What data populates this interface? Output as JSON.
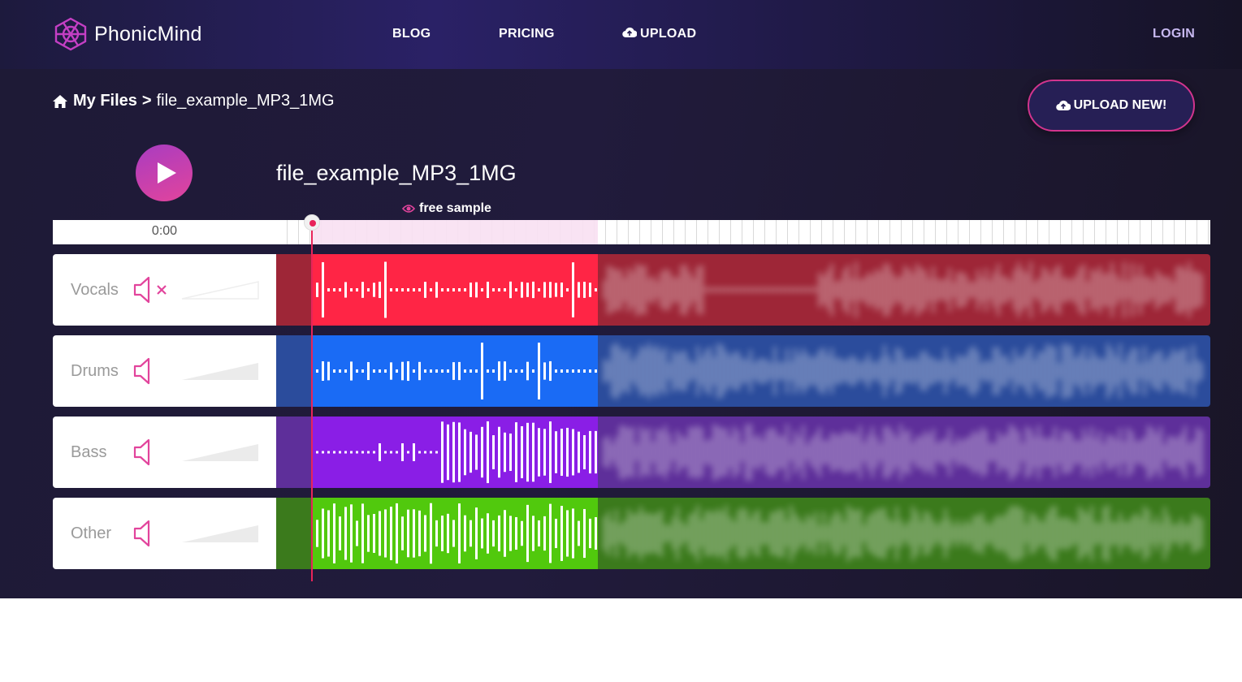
{
  "brand": {
    "name": "PhonicMind"
  },
  "nav": {
    "blog": "BLOG",
    "pricing": "PRICING",
    "upload": "UPLOAD",
    "login": "LOGIN"
  },
  "breadcrumb": {
    "root": "My Files",
    "separator": ">",
    "current": "file_example_MP3_1MG"
  },
  "actions": {
    "upload_new": "UPLOAD NEW!"
  },
  "player": {
    "title": "file_example_MP3_1MG",
    "free_sample_label": "free sample",
    "time": "0:00"
  },
  "icons": {
    "logo": "phonicmind-logo-icon",
    "upload": "cloud-upload-icon",
    "home": "home-icon",
    "play": "play-icon",
    "eye": "eye-icon",
    "speaker": "speaker-icon",
    "mute": "speaker-muted-icon"
  },
  "stems": [
    {
      "name": "Vocals",
      "muted": true,
      "bg": "#9e2637",
      "active": "#ff2545",
      "pre": "#9e2637"
    },
    {
      "name": "Drums",
      "muted": false,
      "bg": "#2b4c9c",
      "active": "#1a6bf5",
      "pre": "#2b4c9c"
    },
    {
      "name": "Bass",
      "muted": false,
      "bg": "#5e2f9a",
      "active": "#8a1ee6",
      "pre": "#5e2f9a"
    },
    {
      "name": "Other",
      "muted": false,
      "bg": "#3b7a1c",
      "active": "#51c90d",
      "pre": "#3b7a1c"
    }
  ],
  "colors": {
    "accent_pink": "#e2449c",
    "accent_purple": "#a93cc1",
    "playhead": "#e8245a",
    "nav_bg": "#2a2166",
    "page_bg": "#1e1a36"
  }
}
